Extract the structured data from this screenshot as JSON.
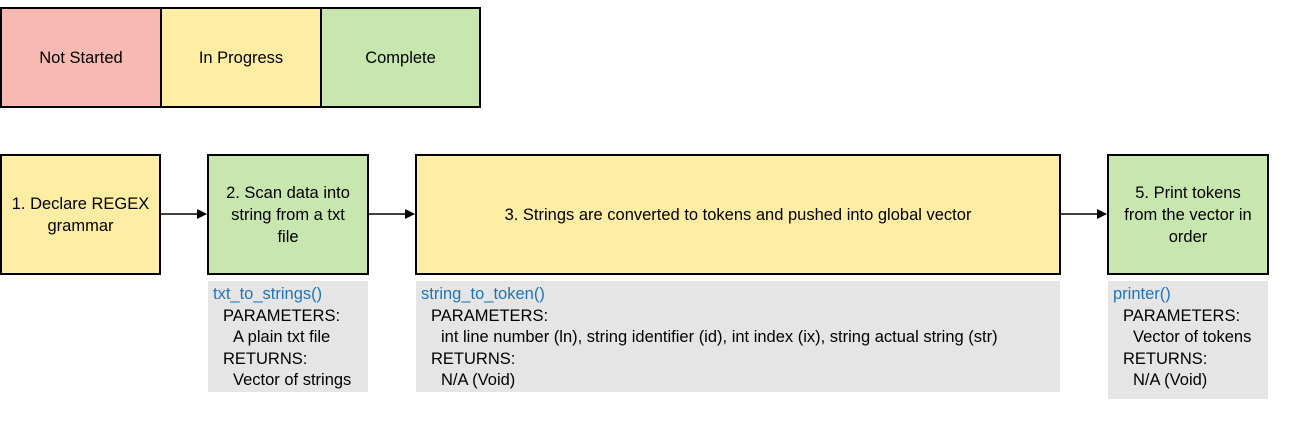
{
  "legend": [
    {
      "label": "Not Started",
      "color": "#f8b9b2"
    },
    {
      "label": "In Progress",
      "color": "#feeda3"
    },
    {
      "label": "Complete",
      "color": "#c8e7ae"
    }
  ],
  "steps": {
    "step1": {
      "label": "1. Declare REGEX grammar",
      "status": "In Progress"
    },
    "step2": {
      "label": "2. Scan data into string from a txt file",
      "status": "Complete"
    },
    "step3": {
      "label": "3. Strings are converted to tokens and pushed into global vector",
      "status": "In Progress"
    },
    "step5": {
      "label": "5. Print tokens from the vector in order",
      "status": "Complete"
    }
  },
  "notes": {
    "txt": {
      "function": "txt_to_strings()",
      "params_label": "PARAMETERS:",
      "params": "A plain txt file",
      "returns_label": "RETURNS:",
      "returns": "Vector of strings"
    },
    "token": {
      "function": "string_to_token()",
      "params_label": "PARAMETERS:",
      "params": "int line number (ln), string identifier (id), int index (ix), string actual string (str)",
      "returns_label": "RETURNS:",
      "returns": "N/A (Void)"
    },
    "printer": {
      "function": "printer()",
      "params_label": "PARAMETERS:",
      "params": "Vector of tokens",
      "returns_label": "RETURNS:",
      "returns": "N/A (Void)"
    }
  },
  "colors": {
    "function_text": "#1c75bc",
    "note_bg": "#e5e5e5",
    "arrow": "#000000"
  }
}
